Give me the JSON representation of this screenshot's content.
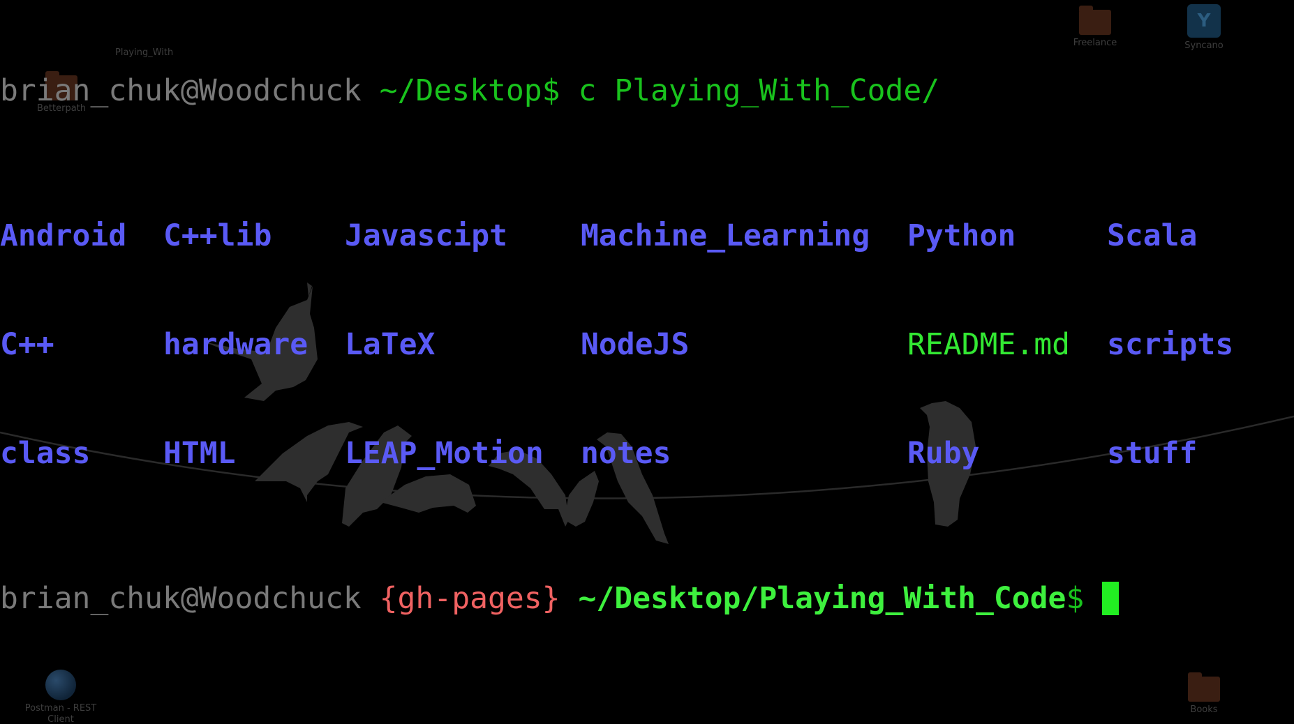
{
  "prompt1": {
    "user_host": "brian_chuk@Woodchuck",
    "path": "~/Desktop",
    "symbol": "$",
    "command": "c Playing_With_Code/"
  },
  "listing": {
    "columns": [
      [
        {
          "name": "Android",
          "type": "dir"
        },
        {
          "name": "C++",
          "type": "dir"
        },
        {
          "name": "class",
          "type": "dir"
        }
      ],
      [
        {
          "name": "C++lib",
          "type": "dir"
        },
        {
          "name": "hardware",
          "type": "dir"
        },
        {
          "name": "HTML",
          "type": "dir"
        }
      ],
      [
        {
          "name": "Javascipt",
          "type": "dir"
        },
        {
          "name": "LaTeX",
          "type": "dir"
        },
        {
          "name": "LEAP_Motion",
          "type": "dir"
        }
      ],
      [
        {
          "name": "Machine_Learning",
          "type": "dir"
        },
        {
          "name": "NodeJS",
          "type": "dir"
        },
        {
          "name": "notes",
          "type": "dir"
        }
      ],
      [
        {
          "name": "Python",
          "type": "dir"
        },
        {
          "name": "README.md",
          "type": "file"
        },
        {
          "name": "Ruby",
          "type": "dir"
        }
      ],
      [
        {
          "name": "Scala",
          "type": "dir"
        },
        {
          "name": "scripts",
          "type": "dir"
        },
        {
          "name": "stuff",
          "type": "dir"
        }
      ]
    ]
  },
  "prompt2": {
    "user_host": "brian_chuk@Woodchuck",
    "branch": "{gh-pages}",
    "path": "~/Desktop/Playing_With_Code",
    "symbol": "$"
  },
  "desktop_icons": {
    "betterpath": "Betterpath",
    "playing_with": "Playing_With",
    "freelance": "Freelance",
    "syncano": "Syncano",
    "syncano_glyph": "Y",
    "postman": "Postman - REST Client",
    "books": "Books"
  },
  "colors": {
    "prompt_gray": "#7a7a7a",
    "path_green": "#19c31d",
    "bold_green": "#3ef03e",
    "branch_red": "#f06262",
    "directory_blue": "#5a5af5",
    "file_green": "#33e833",
    "cursor": "#22ee22",
    "background": "#000000"
  }
}
